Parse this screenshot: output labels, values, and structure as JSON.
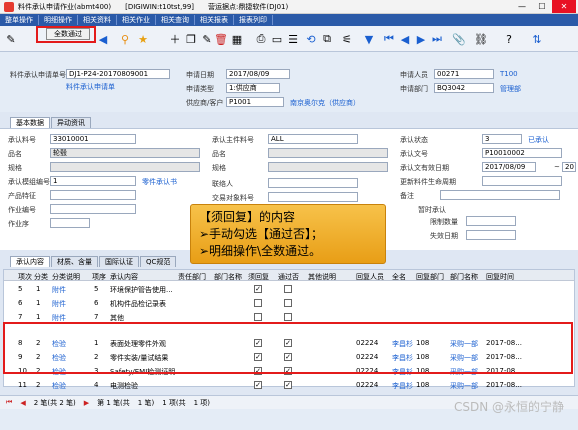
{
  "window": {
    "title": "料件承认申请作业(abmt400)",
    "db": "[DIGIWIN:t10tst,99]",
    "company": "营运据点:鼎捷软件(DJ01)"
  },
  "menu": [
    "整单操作",
    "明细操作",
    "相关资料",
    "相关作业",
    "相关查询",
    "相关报表",
    "报表列印"
  ],
  "toolbar": {
    "all_pass_label": "全数通过"
  },
  "header": {
    "doc_no_label": "料件承认申请单号",
    "doc_no": "DJ1-P24-20170809001",
    "doc_no_link": "料件承认申请单",
    "apply_date_label": "申请日期",
    "apply_date": "2017/08/09",
    "apply_type_label": "申请类型",
    "apply_type": "1:供应商",
    "vendor_label": "供应商/客户",
    "vendor": "P1001",
    "vendor_link": "南京奥尔克（供应商）",
    "applicant_label": "申请人员",
    "applicant": "00271",
    "applicant_link": "T100",
    "dept_label": "申请部门",
    "dept": "BQ3042",
    "dept_link": "管理部"
  },
  "tabs_top": [
    "基本数据",
    "异动资讯"
  ],
  "basic": {
    "item_no_label": "承认料号",
    "item_no": "33010001",
    "item_name_label": "品名",
    "item_name": "轮毂",
    "spec_label": "规格",
    "mold_label": "承认模组编号",
    "mold": "1",
    "mold_link": "零件承认书",
    "feature_label": "产品特征",
    "work_no_label": "作业编号",
    "process_label": "作业序",
    "main_item_label": "承认主件料号",
    "main_item": "ALL",
    "main_name_label": "品名",
    "main_spec_label": "规格",
    "contact_label": "联络人",
    "trade_label": "交易对象料号",
    "status_label": "承认状态",
    "status": "3",
    "status_link": "已承认",
    "doc_label": "承认文号",
    "doc": "P10010002",
    "eff_label": "承认文有效日期",
    "eff_from": "2017/08/09",
    "eff_sep": "~",
    "eff_to": "20",
    "update_label": "更新料件生命周期",
    "remark_label": "备注",
    "temp_label": "暂时承认",
    "limit_qty_label": "限制数量",
    "expire_label": "失效日期"
  },
  "callout": {
    "line1": "【须回复】的内容",
    "line2": "➢手动勾选【通过否】；",
    "line3": "➢明细操作\\全数通过。"
  },
  "tabs_grid": [
    "承认内容",
    "材质、含量",
    "国际认证",
    "QC规范"
  ],
  "grid": {
    "headers": [
      "项次",
      "分类",
      "分类说明",
      "项序",
      "承认内容",
      "责任部门",
      "部门名称",
      "须回复",
      "通过否",
      "其他说明",
      "回复人员",
      "全名",
      "回复部门",
      "部门名称",
      "回复时间"
    ],
    "rows": [
      {
        "no": "5",
        "cat": "1",
        "catdesc": "附件",
        "seq": "5",
        "content": "环境保护管告使用...",
        "reply": true,
        "pass": false,
        "user": "",
        "name": "",
        "rdept": "",
        "rdname": "",
        "time": ""
      },
      {
        "no": "6",
        "cat": "1",
        "catdesc": "附件",
        "seq": "6",
        "content": "机构件品检记录表",
        "reply": false,
        "pass": false,
        "user": "",
        "name": "",
        "rdept": "",
        "rdname": "",
        "time": ""
      },
      {
        "no": "7",
        "cat": "1",
        "catdesc": "附件",
        "seq": "7",
        "content": "其他",
        "reply": false,
        "pass": false,
        "user": "",
        "name": "",
        "rdept": "",
        "rdname": "",
        "time": ""
      },
      {
        "no": "8",
        "cat": "2",
        "catdesc": "检验",
        "seq": "1",
        "content": "表面处理零件外观",
        "reply": true,
        "pass": true,
        "user": "02224",
        "name": "李昌杉",
        "rdept": "108",
        "rdname": "采购一部",
        "time": "2017-08..."
      },
      {
        "no": "9",
        "cat": "2",
        "catdesc": "检验",
        "seq": "2",
        "content": "零件实装/量试结果",
        "reply": true,
        "pass": true,
        "user": "02224",
        "name": "李昌杉",
        "rdept": "108",
        "rdname": "采购一部",
        "time": "2017-08..."
      },
      {
        "no": "10",
        "cat": "2",
        "catdesc": "检验",
        "seq": "3",
        "content": "Safety/EMI检测证明",
        "reply": true,
        "pass": true,
        "user": "02224",
        "name": "李昌杉",
        "rdept": "108",
        "rdname": "采购一部",
        "time": "2017-08..."
      },
      {
        "no": "11",
        "cat": "2",
        "catdesc": "检验",
        "seq": "4",
        "content": "电测检验",
        "reply": true,
        "pass": true,
        "user": "02224",
        "name": "李昌杉",
        "rdept": "108",
        "rdname": "采购一部",
        "time": "2017-08..."
      }
    ]
  },
  "status": [
    "2 笔(共 2 笔)",
    "第 1 笔(共",
    "1 笔)",
    "1 项(共",
    "1 项)"
  ],
  "watermark": "CSDN @永恒的宁静"
}
